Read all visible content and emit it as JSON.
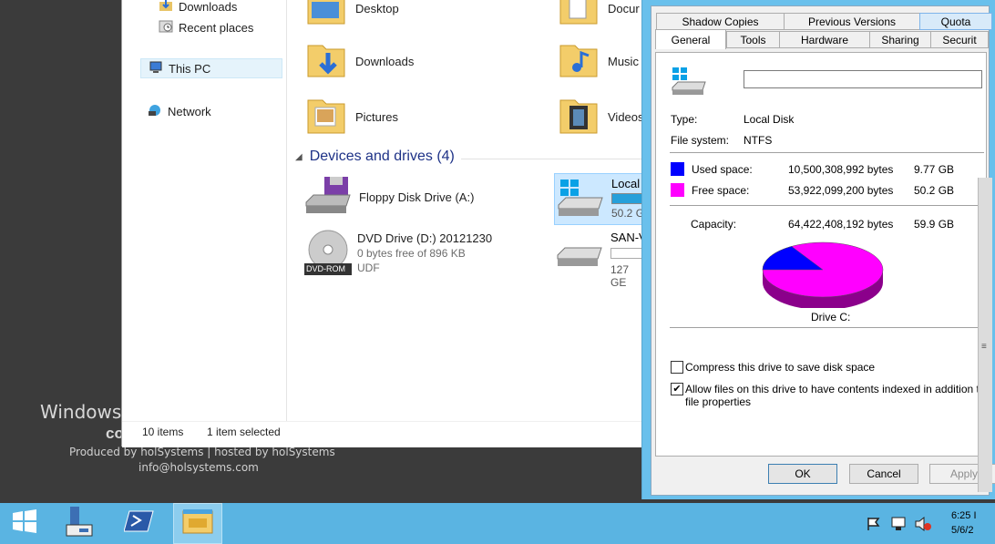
{
  "desktop": {
    "watermark_title": "Windows",
    "watermark_sub": "co",
    "produced": "Produced by holSystems | hosted by holSystems",
    "email": "info@holsystems.com"
  },
  "explorer": {
    "nav": {
      "downloads": "Downloads",
      "recent": "Recent places",
      "this_pc": "This PC",
      "network": "Network"
    },
    "folders": {
      "desktop": "Desktop",
      "documents": "Docur",
      "downloads": "Downloads",
      "music": "Music",
      "pictures": "Pictures",
      "videos": "Videos"
    },
    "devices_header": "Devices and drives (4)",
    "drives": {
      "floppy": "Floppy Disk Drive (A:)",
      "dvd_name": "DVD Drive (D:) 20121230",
      "dvd_free": "0 bytes free of 896 KB",
      "dvd_fs": "UDF",
      "dvd_badge": "DVD-ROM",
      "local_name": "Local",
      "local_free": "50.2 G",
      "san_name": "SAN-V",
      "san_free": "127 GE"
    },
    "status": {
      "items": "10 items",
      "selected": "1 item selected"
    }
  },
  "dialog": {
    "tabs_row1": [
      "Shadow Copies",
      "Previous Versions",
      "Quota"
    ],
    "tabs_row2": [
      "General",
      "Tools",
      "Hardware",
      "Sharing",
      "Securit"
    ],
    "name_value": "",
    "type_label": "Type:",
    "type_value": "Local Disk",
    "fs_label": "File system:",
    "fs_value": "NTFS",
    "used_label": "Used space:",
    "used_bytes": "10,500,308,992 bytes",
    "used_gb": "9.77 GB",
    "free_label": "Free space:",
    "free_bytes": "53,922,099,200 bytes",
    "free_gb": "50.2 GB",
    "capacity_label": "Capacity:",
    "capacity_bytes": "64,422,408,192 bytes",
    "capacity_gb": "59.9 GB",
    "drive_label": "Drive C:",
    "compress_label": "Compress this drive to save disk space",
    "compress_checked": false,
    "index_label_1": "Allow files on this drive to have contents indexed in addition to",
    "index_label_2": "file properties",
    "index_checked": true,
    "ok": "OK",
    "cancel": "Cancel",
    "apply": "Apply",
    "used_color": "#0000ff",
    "free_color": "#ff00ff",
    "used_fraction": 0.163
  },
  "taskbar": {
    "time": "6:25 I",
    "date": "5/6/2"
  }
}
